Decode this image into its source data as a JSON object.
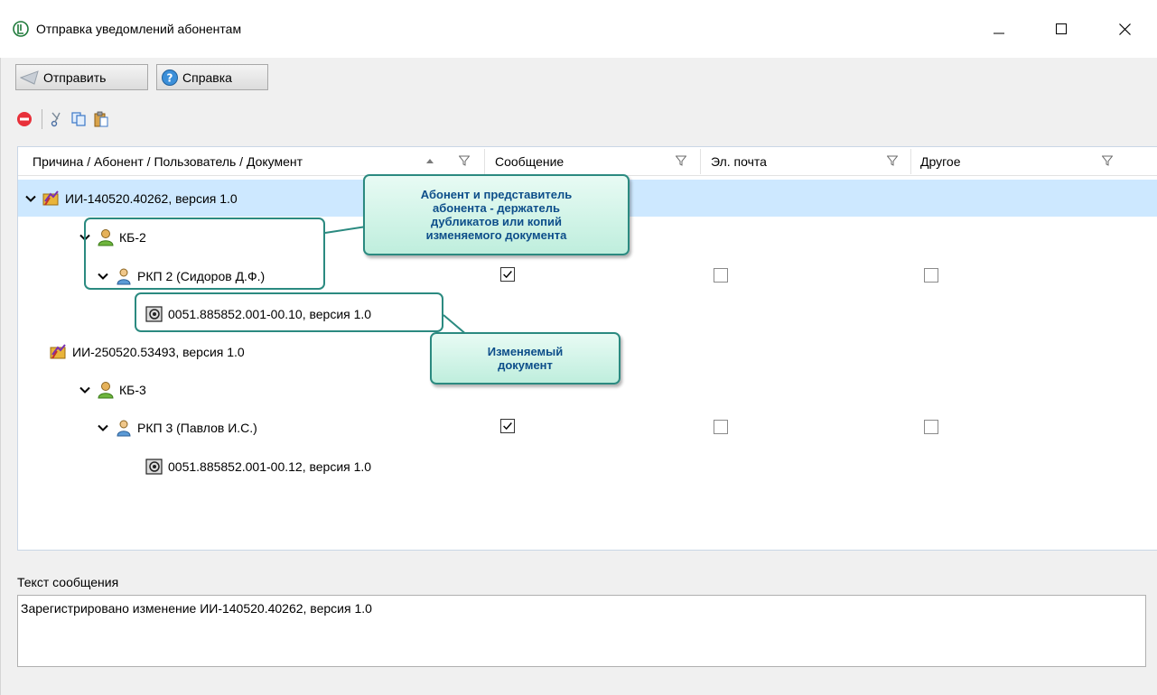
{
  "window": {
    "title": "Отправка уведомлений абонентам"
  },
  "toolbar": {
    "send_label": "Отправить",
    "help_label": "Справка"
  },
  "grid": {
    "columns": [
      "Причина / Абонент / Пользователь / Документ",
      "Сообщение",
      "Эл. почта",
      "Другое"
    ],
    "rows": [
      {
        "text": "ИИ-140520.40262, версия 1.0",
        "icon": "change-notice-icon",
        "expanded": true,
        "selected": true
      },
      {
        "text": "КБ-2",
        "icon": "subscriber-icon",
        "expanded": true
      },
      {
        "text": "РКП 2 (Сидоров Д.Ф.)",
        "icon": "user-icon",
        "expanded": true,
        "message": true,
        "email": false,
        "other": false
      },
      {
        "text": "0051.885852.001-00.10, версия 1.0",
        "icon": "document-icon"
      },
      {
        "text": "ИИ-250520.53493, версия 1.0",
        "icon": "change-notice-icon"
      },
      {
        "text": "КБ-3",
        "icon": "subscriber-icon",
        "expanded": true
      },
      {
        "text": "РКП 3 (Павлов И.С.)",
        "icon": "user-icon",
        "expanded": true,
        "message": true,
        "email": false,
        "other": false
      },
      {
        "text": "0051.885852.001-00.12, версия 1.0",
        "icon": "document-icon"
      }
    ]
  },
  "callouts": {
    "subscriber_lines": [
      "Абонент и представитель",
      "абонента - держатель",
      "дубликатов или копий",
      "изменяемого документа"
    ],
    "document_lines": [
      "Изменяемый",
      "документ"
    ]
  },
  "message": {
    "label": "Текст сообщения",
    "text": "Зарегистрировано изменение ИИ-140520.40262, версия 1.0"
  },
  "colors": {
    "selection": "#cde8ff",
    "callout_border": "#2b8a80",
    "callout_text": "#0d4e8a"
  }
}
